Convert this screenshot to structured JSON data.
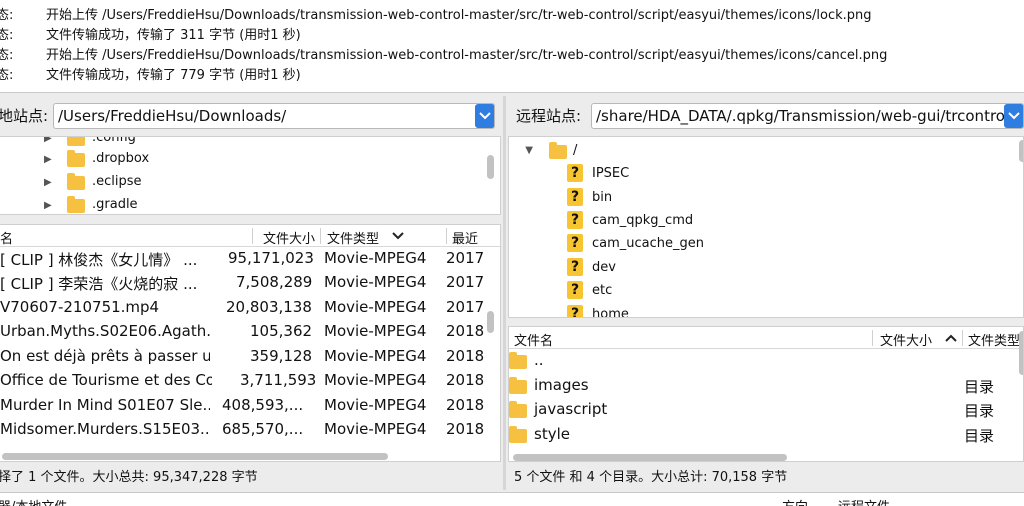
{
  "log": [
    {
      "tag": "态:",
      "message": "开始上传 /Users/FreddieHsu/Downloads/transmission-web-control-master/src/tr-web-control/script/easyui/themes/icons/lock.png"
    },
    {
      "tag": "态:",
      "message": "文件传输成功，传输了 311 字节 (用时1 秒)"
    },
    {
      "tag": "态:",
      "message": "开始上传 /Users/FreddieHsu/Downloads/transmission-web-control-master/src/tr-web-control/script/easyui/themes/icons/cancel.png"
    },
    {
      "tag": "态:",
      "message": "文件传输成功，传输了 779 字节 (用时1 秒)"
    }
  ],
  "local": {
    "label": "地站点:",
    "path": "/Users/FreddieHsu/Downloads/",
    "tree": [
      ".config",
      ".dropbox",
      ".eclipse",
      ".gradle"
    ],
    "headers": {
      "name": "名",
      "size": "文件大小",
      "type": "文件类型",
      "modified": "最近"
    },
    "files": [
      {
        "name": "[ CLIP ] 林俊杰《女儿情》 ...",
        "size": "95,171,023",
        "type": "Movie-MPEG4",
        "modified": "2017"
      },
      {
        "name": "[ CLIP ] 李荣浩《火烧的寂 ...",
        "size": "7,508,289",
        "type": "Movie-MPEG4",
        "modified": "2017"
      },
      {
        "name": "V70607-210751.mp4",
        "size": "20,803,138",
        "type": "Movie-MPEG4",
        "modified": "2017"
      },
      {
        "name": "Urban.Myths.S02E06.Agath.",
        "size": "105,362",
        "type": "Movie-MPEG4",
        "modified": "2018"
      },
      {
        "name": "On est déjà prêts à passer u.",
        "size": "359,128",
        "type": "Movie-MPEG4",
        "modified": "2018"
      },
      {
        "name": "Office de Tourisme et des Co",
        "size": "3,711,593",
        "type": "Movie-MPEG4",
        "modified": "2018"
      },
      {
        "name": "Murder In Mind S01E07 Sle...",
        "size": "408,593,...",
        "type": "Movie-MPEG4",
        "modified": "2018"
      },
      {
        "name": "Midsomer.Murders.S15E03...",
        "size": "685,570,...",
        "type": "Movie-MPEG4",
        "modified": "2018"
      }
    ],
    "status": "择了 1 个文件。大小总共: 95,347,228 字节"
  },
  "remote": {
    "label": "远程站点:",
    "path": "/share/HDA_DATA/.qpkg/Transmission/web-gui/trcontro",
    "root": "/",
    "tree": [
      "IPSEC",
      "bin",
      "cam_qpkg_cmd",
      "cam_ucache_gen",
      "dev",
      "etc",
      "home"
    ],
    "headers": {
      "name": "文件名",
      "size": "文件大小",
      "type": "文件类型"
    },
    "files": [
      {
        "name": "..",
        "type": ""
      },
      {
        "name": "images",
        "type": "目录"
      },
      {
        "name": "javascript",
        "type": "目录"
      },
      {
        "name": "style",
        "type": "目录"
      }
    ],
    "status": "5 个文件 和 4 个目录。大小总计: 70,158 字节"
  },
  "queue": {
    "col1": "器/本地文件",
    "col2": "方向",
    "col3": "远程文件"
  },
  "colors": {
    "accent": "#2f7de1",
    "folder": "#f6c140",
    "background": "#ececec"
  }
}
